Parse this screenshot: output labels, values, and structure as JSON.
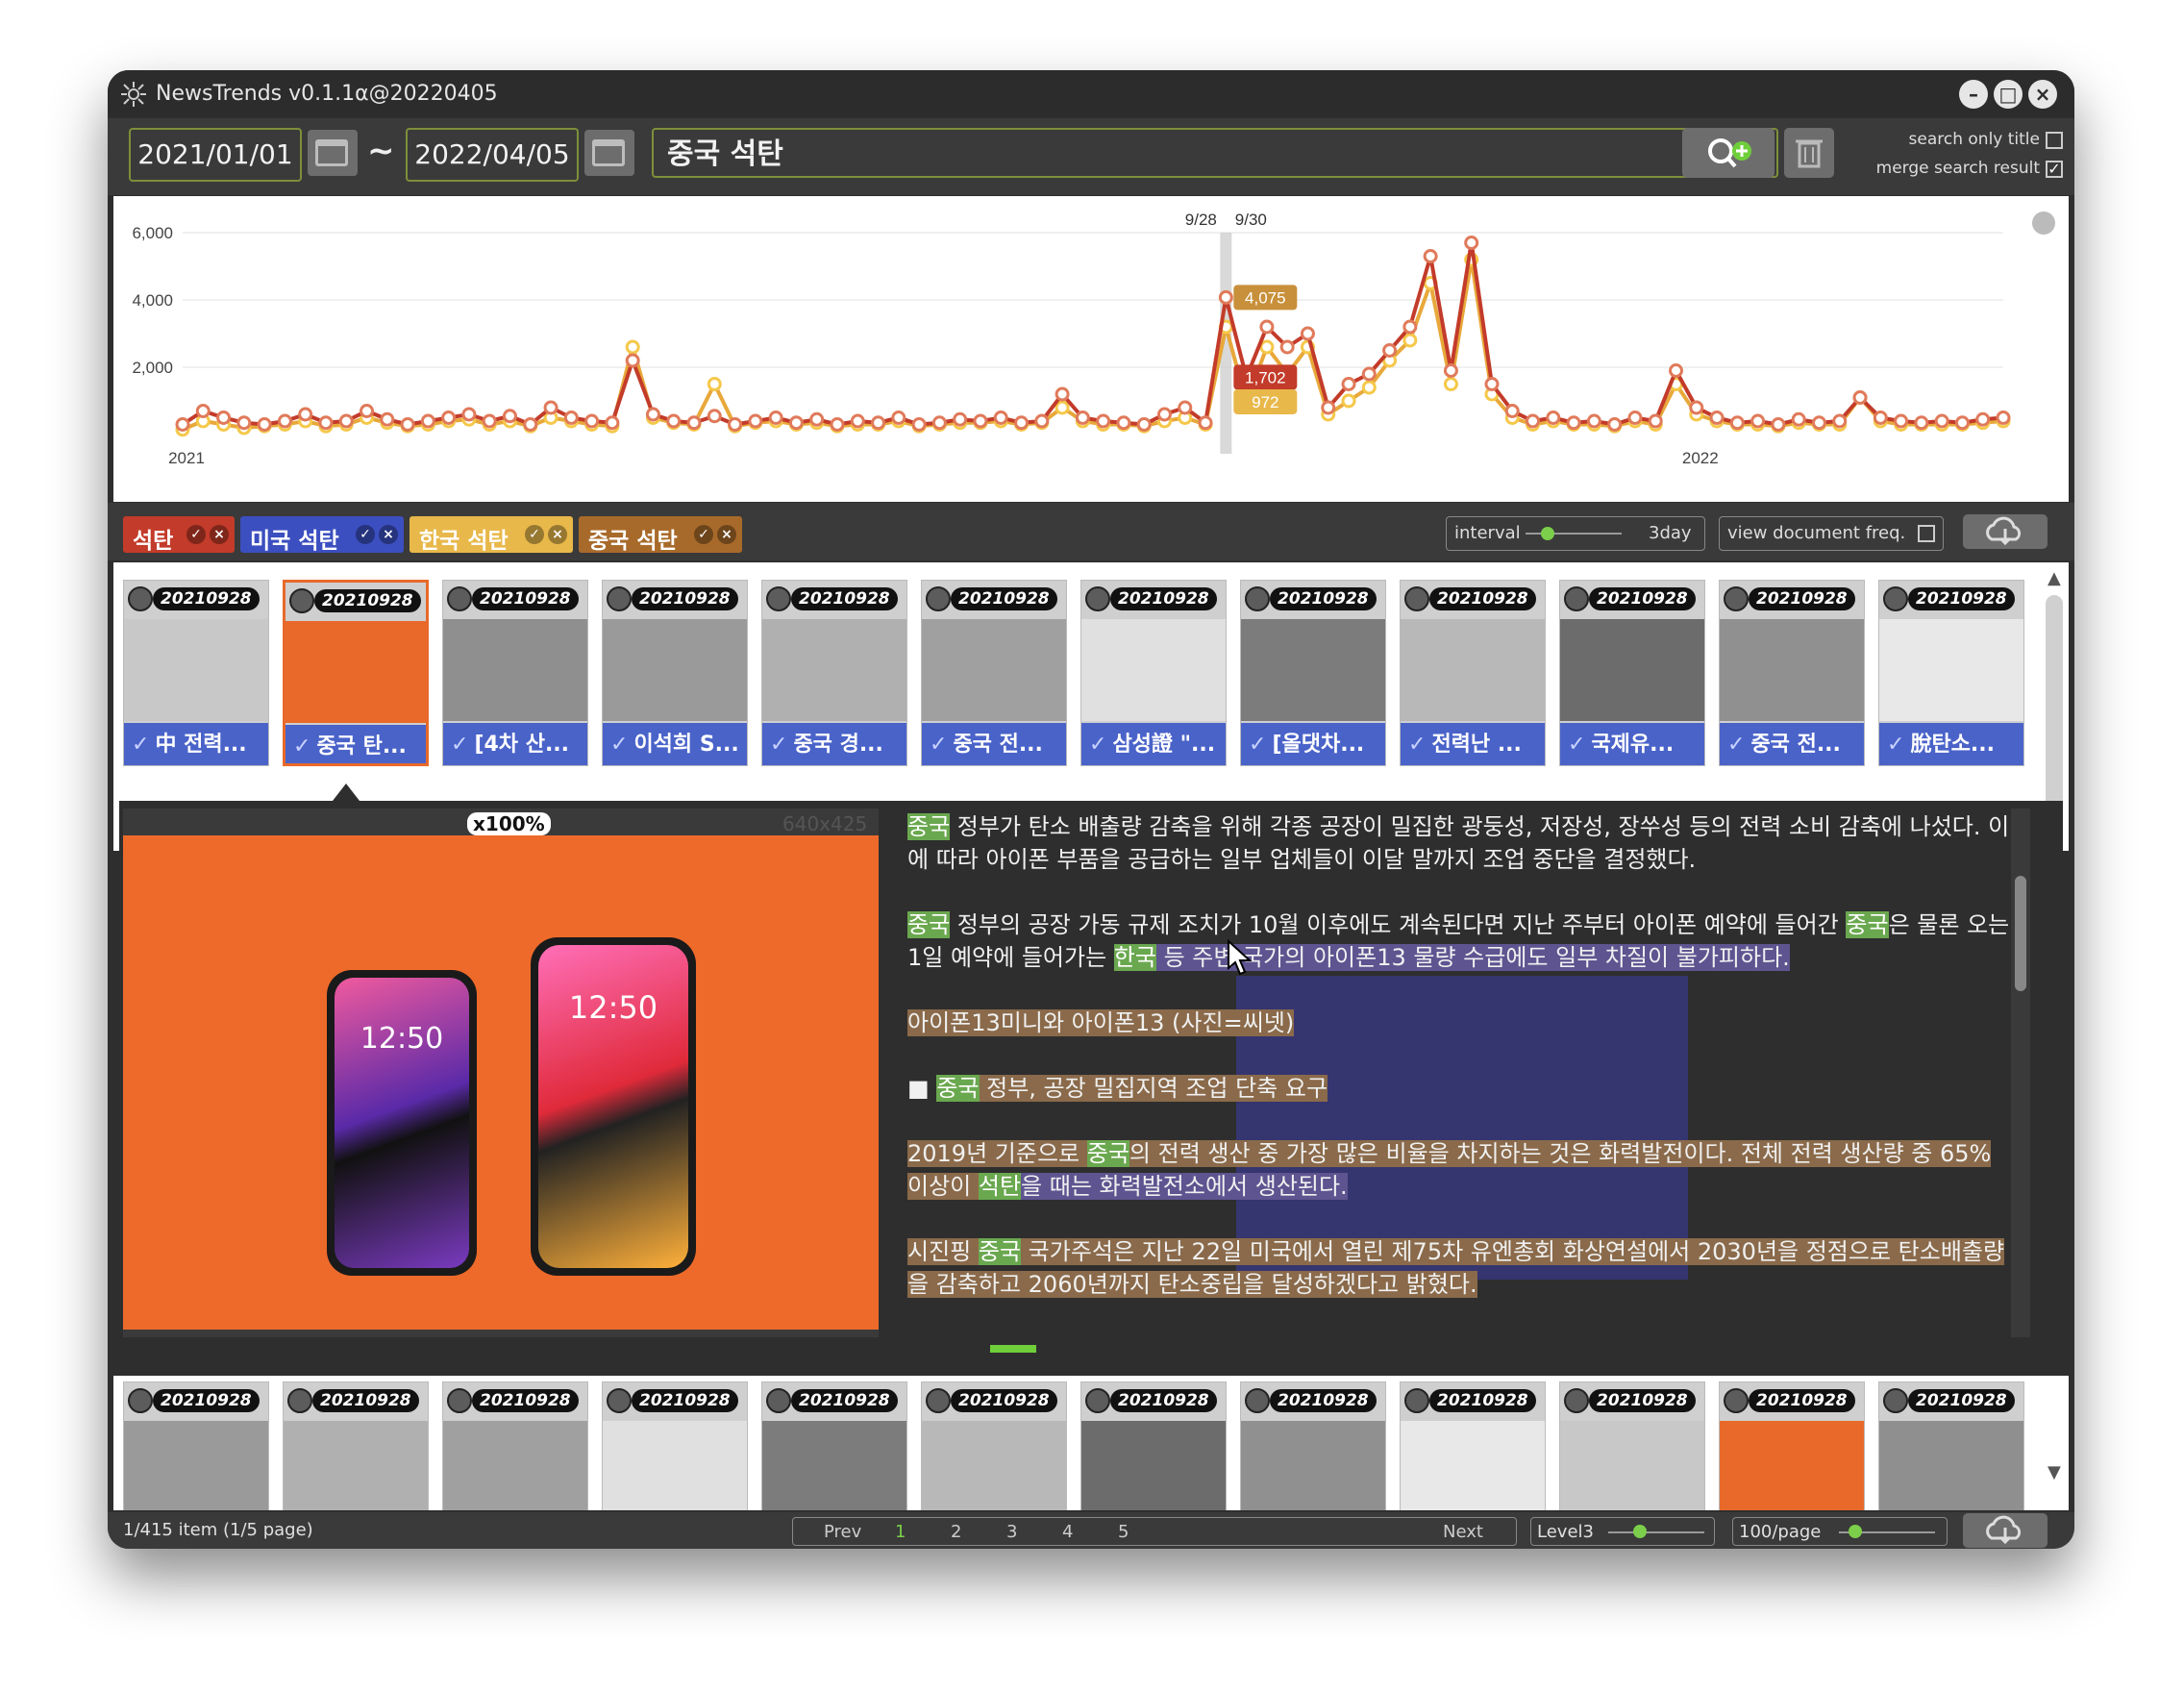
{
  "app": {
    "title": "NewsTrends v0.1.1α@20220405"
  },
  "search": {
    "start_date": "2021/01/01",
    "tilde": "~",
    "end_date": "2022/04/05",
    "query": "중국 석탄",
    "search_only_title_label": "search only title",
    "search_only_title_checked": false,
    "merge_search_result_label": "merge search result",
    "merge_search_result_checked": true
  },
  "chart_data": {
    "type": "line",
    "x_tick_labels": [
      "2021",
      "2022"
    ],
    "y_tick_labels": [
      "2,000",
      "4,000",
      "6,000"
    ],
    "ylim": [
      0,
      6000
    ],
    "highlight_labels": [
      "9/28",
      "9/30"
    ],
    "data_labels": [
      "4,075",
      "1,702",
      "972"
    ],
    "series": [
      {
        "name": "석탄",
        "color": "#c33b2a",
        "values": [
          300,
          700,
          500,
          350,
          300,
          400,
          600,
          350,
          400,
          700,
          450,
          300,
          400,
          500,
          600,
          400,
          550,
          300,
          800,
          500,
          400,
          350,
          2200,
          600,
          400,
          350,
          550,
          300,
          400,
          500,
          350,
          450,
          300,
          400,
          350,
          500,
          300,
          350,
          450,
          400,
          500,
          350,
          400,
          1200,
          500,
          400,
          350,
          300,
          600,
          800,
          350,
          4075,
          1702,
          3200,
          2600,
          3000,
          800,
          1500,
          1800,
          2500,
          3200,
          5300,
          1900,
          5700,
          1500,
          700,
          400,
          500,
          350,
          400,
          300,
          500,
          400,
          1900,
          800,
          500,
          350,
          400,
          300,
          450,
          350,
          400,
          1100,
          500,
          400,
          350,
          400,
          350,
          450,
          500
        ]
      },
      {
        "name": "중국 석탄",
        "color": "#e8a83a",
        "values": [
          150,
          400,
          300,
          200,
          250,
          300,
          400,
          250,
          300,
          500,
          350,
          250,
          300,
          400,
          450,
          300,
          400,
          250,
          500,
          400,
          300,
          250,
          2600,
          500,
          350,
          300,
          1500,
          250,
          350,
          400,
          300,
          350,
          250,
          300,
          300,
          400,
          250,
          300,
          350,
          350,
          400,
          300,
          350,
          800,
          400,
          300,
          300,
          250,
          400,
          500,
          300,
          3200,
          972,
          2600,
          1800,
          2600,
          600,
          1000,
          1400,
          2200,
          2800,
          4500,
          1500,
          5200,
          1200,
          500,
          300,
          400,
          300,
          300,
          250,
          400,
          300,
          1500,
          600,
          400,
          300,
          300,
          250,
          350,
          300,
          300,
          1100,
          400,
          300,
          300,
          300,
          300,
          350,
          400
        ]
      }
    ]
  },
  "legend": {
    "tags": [
      {
        "label": "석탄",
        "bg": "#c33b2a"
      },
      {
        "label": "미국 석탄",
        "bg": "#3b4fc0"
      },
      {
        "label": "한국 석탄",
        "bg": "#e8b84a"
      },
      {
        "label": "중국 석탄",
        "bg": "#a86a2a"
      }
    ],
    "interval_label": "interval",
    "interval_value": "3day",
    "view_doc_freq_label": "view document freq."
  },
  "thumbnails": [
    {
      "date": "20210928",
      "caption": "中 전력..."
    },
    {
      "date": "20210928",
      "caption": "중국 탄..."
    },
    {
      "date": "20210928",
      "caption": "[4차 산..."
    },
    {
      "date": "20210928",
      "caption": "이석희 S..."
    },
    {
      "date": "20210928",
      "caption": "중국 경..."
    },
    {
      "date": "20210928",
      "caption": "중국 전..."
    },
    {
      "date": "20210928",
      "caption": "삼성證 \"..."
    },
    {
      "date": "20210928",
      "caption": "[올댓차..."
    },
    {
      "date": "20210928",
      "caption": "전력난 ..."
    },
    {
      "date": "20210928",
      "caption": "국제유..."
    },
    {
      "date": "20210928",
      "caption": "중국 전..."
    },
    {
      "date": "20210928",
      "caption": "脫탄소..."
    }
  ],
  "detail": {
    "zoom_label": "x100%",
    "image_size": "640x425",
    "phone_time": "12:50",
    "para1_a": "중국",
    "para1_b": " 정부가 탄소 배출량 감축을 위해 각종 공장이 밀집한 광둥성, 저장성, 장쑤성 등의 전력 소비 감축에 나섰다. 이에 따라 아이폰 부품을 공급하는 일부 업체들이 이달 말까지 조업 중단을 결정했다.",
    "para2_a": "중국",
    "para2_b": " 정부의 공장 가동 규제 조치가 10월 이후에도 계속된다면 지난 주부터 아이폰 예약에 들어간 ",
    "para2_c": "중국",
    "para2_d": "은 물론 오는 1일 예약에 들어가는 ",
    "para2_e": "한국",
    "para2_f": " 등 주변 국가의 아이폰13 물량 수급에도 일부 차질이 불가피하다.",
    "para3": "아이폰13미니와 아이폰13 (사진=씨넷)",
    "para4_box": "■",
    "para4_a": "중국",
    "para4_b": " 정부, 공장 밀집지역 조업 단축 요구",
    "para5_a": "2019년 기준으로 ",
    "para5_b": "중국",
    "para5_c": "의 전력 생산 중 가장 많은 비율을 차지하는 것은 화력발전이다. 전체 전력 생산량 중 65% 이상이 ",
    "para5_d": "석탄",
    "para5_e": "을 때는 화력발전소에서 생산된다.",
    "para6_a": "시진핑 ",
    "para6_b": "중국",
    "para6_c": " 국가주석은 지난 22일 미국에서 열린 제75차 유엔총회 화상연설에서 2030년을 정점으로 탄소배출량을 감축하고 2060년까지 탄소중립을 달성하겠다고 밝혔다."
  },
  "bottom_thumbnails": [
    "20210928",
    "20210928",
    "20210928",
    "20210928",
    "20210928",
    "20210928",
    "20210928",
    "20210928",
    "20210928",
    "20210928",
    "20210928",
    "20210928"
  ],
  "status": {
    "item_info": "1/415 item (1/5 page)",
    "prev": "Prev",
    "pages": [
      "1",
      "2",
      "3",
      "4",
      "5"
    ],
    "current_page": "1",
    "next": "Next",
    "level": "Level3",
    "per_page": "100/page"
  }
}
